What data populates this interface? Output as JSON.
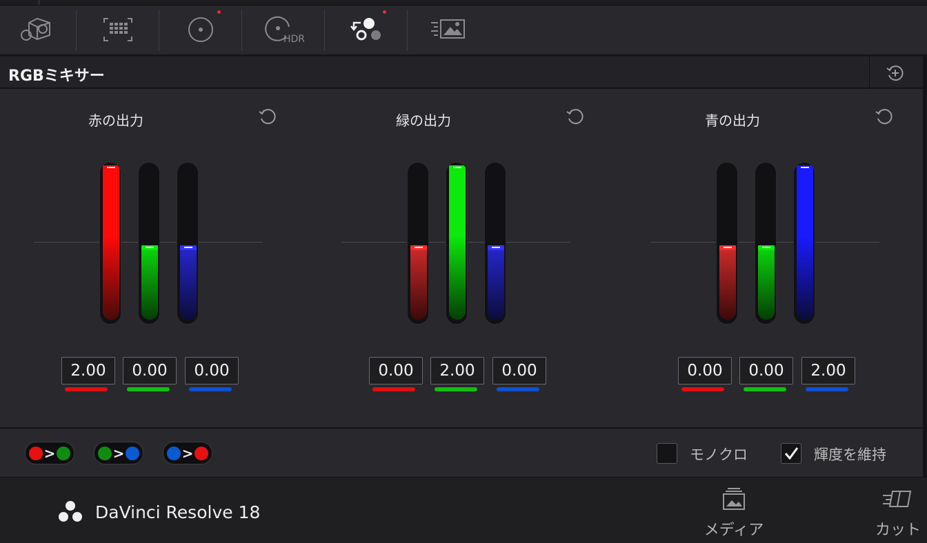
{
  "toolbar": {
    "tools": [
      {
        "icon": "camera-raw-icon",
        "dot": false
      },
      {
        "icon": "color-match-icon",
        "dot": false
      },
      {
        "icon": "color-wheels-icon",
        "dot": true
      },
      {
        "icon": "hdr-wheels-icon",
        "label": "HDR",
        "dot": false
      },
      {
        "icon": "rgb-mixer-icon",
        "dot": true
      },
      {
        "icon": "motion-effects-icon",
        "dot": false
      }
    ]
  },
  "panel": {
    "title": "RGBミキサー",
    "groups": [
      {
        "title": "赤の出力",
        "values": [
          "2.00",
          "0.00",
          "0.00"
        ]
      },
      {
        "title": "緑の出力",
        "values": [
          "0.00",
          "2.00",
          "0.00"
        ]
      },
      {
        "title": "青の出力",
        "values": [
          "0.00",
          "0.00",
          "2.00"
        ]
      }
    ]
  },
  "bottom": {
    "swaps": [
      {
        "from": "red",
        "to": "green"
      },
      {
        "from": "green",
        "to": "blue"
      },
      {
        "from": "blue",
        "to": "red"
      }
    ],
    "swap_glyph": ">",
    "monochrome_label": "モノクロ",
    "monochrome_checked": false,
    "preserve_label": "輝度を維持",
    "preserve_checked": true
  },
  "statusbar": {
    "brand": "DaVinci Resolve 18",
    "pages": [
      {
        "label": "メディア",
        "icon": "media-page-icon"
      },
      {
        "label": "カット",
        "icon": "cut-page-icon"
      }
    ]
  },
  "colors": {
    "red": "#ff0a0a",
    "green": "#0bea0b",
    "blue": "#1a1aff",
    "red_dot": "#e81010",
    "green_dot": "#108c10",
    "blue_dot": "#0a5ad0",
    "notify_dot": "#e5312b"
  }
}
